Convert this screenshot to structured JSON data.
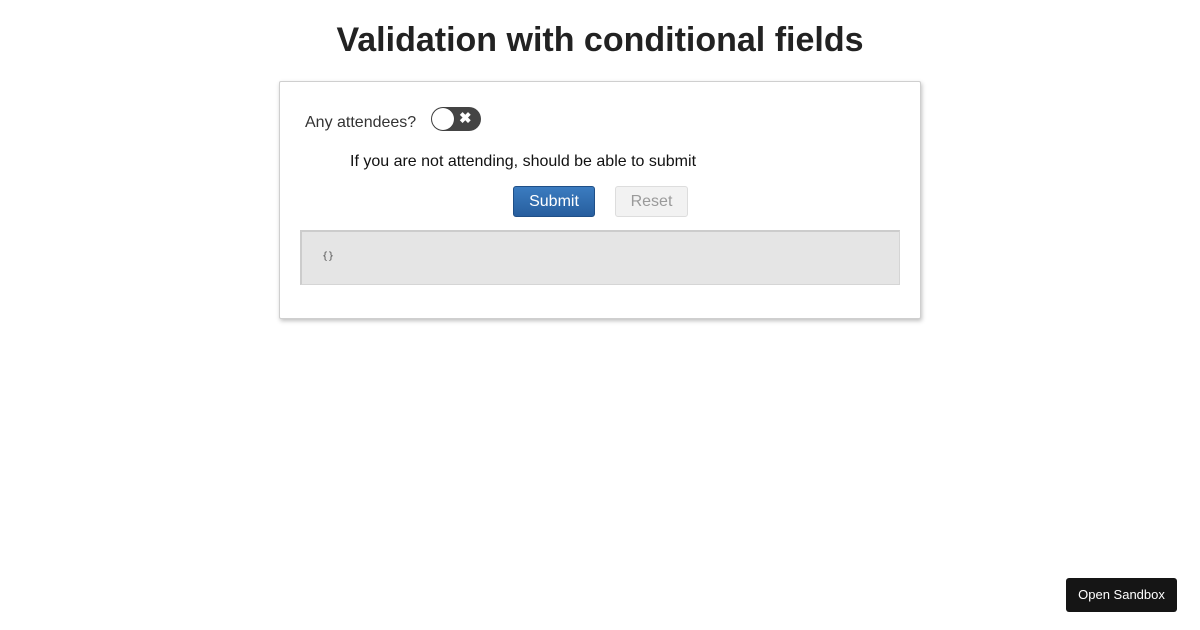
{
  "page": {
    "title": "Validation with conditional fields"
  },
  "form": {
    "attendees_label": "Any attendees?",
    "toggle": {
      "checked": false,
      "off_icon": "✖",
      "icon_name": "close-icon"
    },
    "hint": "If you are not attending, should be able to submit",
    "submit_label": "Submit",
    "reset_label": "Reset",
    "output": "{}"
  },
  "sandbox": {
    "label": "Open Sandbox"
  },
  "colors": {
    "accent": "#2b6cb0",
    "toggle_bg": "#444444",
    "output_bg": "#e5e5e5",
    "sandbox_bg": "#151515"
  }
}
